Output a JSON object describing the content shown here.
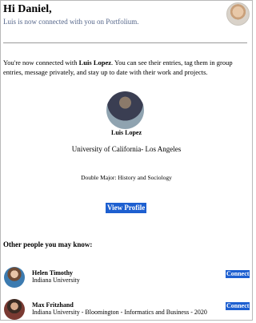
{
  "header": {
    "greeting": "Hi Daniel,",
    "subtitle": "Luis is now connected with you on Portfolium."
  },
  "intro": {
    "before": "You're now connected with ",
    "name": "Luis Lopez",
    "after": ". You can see their entries, tag them in group entries, message privately, and stay up to date with their work and projects."
  },
  "profile": {
    "name": "Luis Lopez",
    "school": "University of California- Los Angeles",
    "major": "Double Major: History and Sociology",
    "button_label": "View Profile"
  },
  "suggestions": {
    "title": "Other people you may know:",
    "people": [
      {
        "name": "Helen Timothy",
        "school": "Indiana University",
        "button_label": "Connect"
      },
      {
        "name": "Max Fritzhand",
        "school": "Indiana University - Bloomington - Informatics and Business - 2020",
        "button_label": "Connect"
      }
    ]
  },
  "colors": {
    "accent": "#1d5fd0",
    "subtitle": "#55668a",
    "divider": "#9a9a9a"
  }
}
